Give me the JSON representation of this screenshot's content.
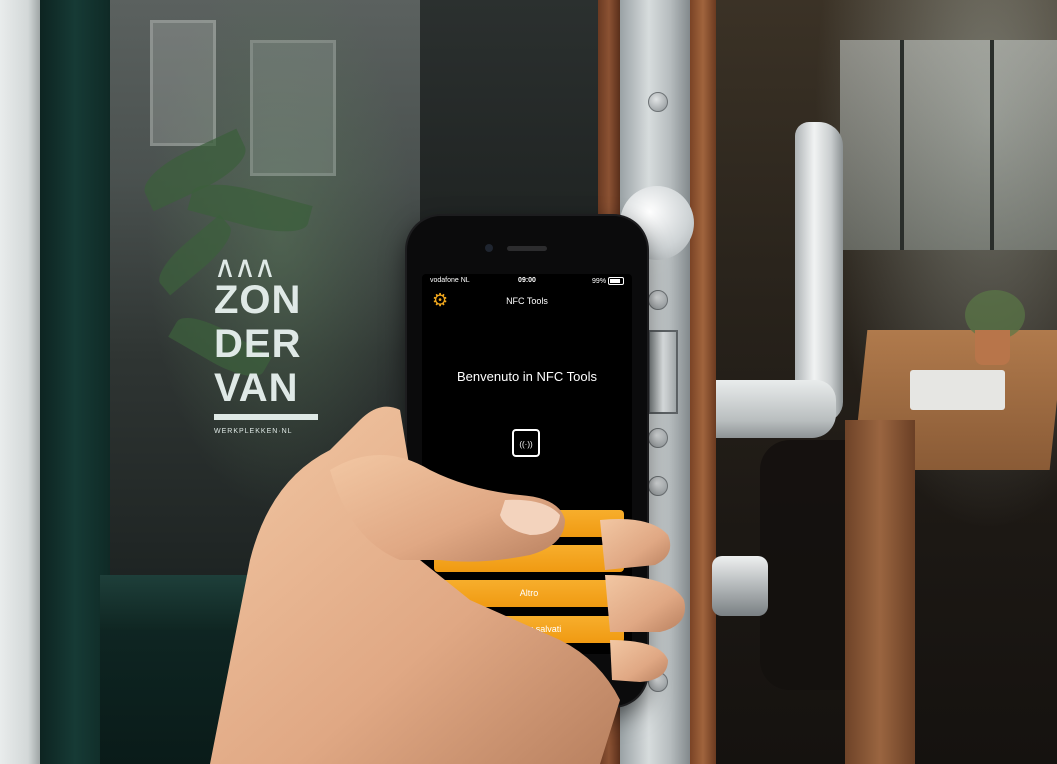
{
  "scene": {
    "window_logo": {
      "mark": "∧∧∧",
      "lines": [
        "ZON",
        "DER",
        "VAN"
      ],
      "subtitle": "WERKPLEKKEN·NL"
    }
  },
  "phone": {
    "status_bar": {
      "carrier": "vodafone NL",
      "time": "09:00",
      "battery": "99%"
    },
    "nav_title": "NFC Tools",
    "welcome_text": "Benvenuto in NFC Tools",
    "menu_buttons": [
      {
        "label": "",
        "icon": "tag-icon"
      },
      {
        "label": ""
      },
      {
        "label": "Altro"
      },
      {
        "label": "I miei tag salvati"
      }
    ],
    "accent_color": "#f4a522",
    "gear_icon": "gear-icon",
    "nfc_icon": "nfc-icon"
  }
}
